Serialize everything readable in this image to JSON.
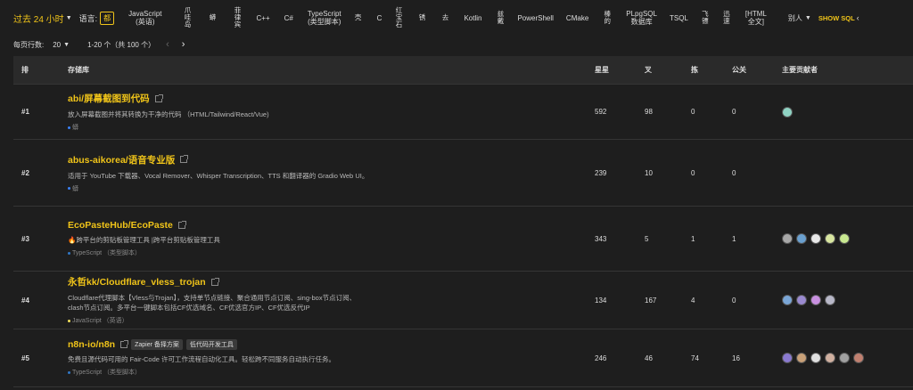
{
  "filters": {
    "time_range": "过去 24 小时",
    "language_label": "语言:",
    "language_selected": "都",
    "languages": [
      {
        "label": "JavaScript\n(英语)",
        "stack": false
      },
      {
        "label": "爪哇岛",
        "stack": true
      },
      {
        "label": "蟒",
        "stack": true
      },
      {
        "label": "菲律宾",
        "stack": true
      },
      {
        "label": "C++",
        "stack": false
      },
      {
        "label": "C#",
        "stack": false
      },
      {
        "label": "TypeScript\n(类型脚本)",
        "stack": false
      },
      {
        "label": "壳",
        "stack": true
      },
      {
        "label": "C",
        "stack": false
      },
      {
        "label": "红宝石",
        "stack": true
      },
      {
        "label": "锈",
        "stack": true
      },
      {
        "label": "去",
        "stack": true
      },
      {
        "label": "Kotlin",
        "stack": false
      },
      {
        "label": "兹戴",
        "stack": true
      },
      {
        "label": "PowerShell",
        "stack": false
      },
      {
        "label": "CMake",
        "stack": false
      },
      {
        "label": "榛的",
        "stack": true
      },
      {
        "label": "PLpgSQL\n数据库",
        "stack": false
      },
      {
        "label": "TSQL",
        "stack": false
      },
      {
        "label": "飞镖",
        "stack": true
      },
      {
        "label": "迅速",
        "stack": true
      },
      {
        "label": "[HTML\n全文]",
        "stack": false
      }
    ],
    "more_label": "别人",
    "show_sql_label": "SHOW SQL"
  },
  "pager": {
    "rows_per_page_label": "每页行数:",
    "rows_per_page_value": "20",
    "range_text": "1-20 个（共 100 个）"
  },
  "table": {
    "headers": {
      "rank": "排",
      "repo": "存储库",
      "stars": "星星",
      "forks": "叉",
      "merges": "拣",
      "issues": "公关",
      "contributors": "主要贡献者"
    },
    "rows": [
      {
        "rank": "#1",
        "name": "abi/屏幕截图到代码",
        "tags": [],
        "description": "放入屏幕截图并将其转换为干净的代码 （HTML/Tailwind/React/Vue)",
        "language": "蟒",
        "stars": "592",
        "forks": "98",
        "merges": "0",
        "issues": "0",
        "avatar_colors": [
          "#8fd3c3"
        ]
      },
      {
        "rank": "#2",
        "name": "abus-aikorea/语音专业版",
        "tags": [],
        "description": "适用于 YouTube 下载器、Vocal Remover、Whisper Transcription、TTS 和翻译器的 Gradio Web UI。",
        "language": "蟒",
        "stars": "239",
        "forks": "10",
        "merges": "0",
        "issues": "0",
        "avatar_colors": []
      },
      {
        "rank": "#3",
        "name": "EcoPasteHub/EcoPaste",
        "tags": [],
        "description": "🔥跨平台的剪贴板管理工具 |跨平台剪贴板管理工具",
        "language": "TypeScript （类型脚本）",
        "stars": "343",
        "forks": "5",
        "merges": "1",
        "issues": "1",
        "avatar_colors": [
          "#a8a8a8",
          "#6aa0d0",
          "#e8e8e8",
          "#d8e6a0",
          "#c8e890"
        ]
      },
      {
        "rank": "#4",
        "name": "永哲kk/Cloudflare_vless_trojan",
        "tags": [],
        "description": "Cloudflare代理脚本【Vless与Trojan】，支持单节点链接、聚合通用节点订阅、sing-box节点订阅、clash节点订阅。多平台一键脚本包括CF优选域名、CF优选官方IP、CF优选反代IP",
        "language": "JavaScript （英语）",
        "stars": "134",
        "forks": "167",
        "merges": "4",
        "issues": "0",
        "avatar_colors": [
          "#7aa6d6",
          "#9a8ad0",
          "#c890e0",
          "#b8b8c8"
        ]
      },
      {
        "rank": "#5",
        "name": "n8n-io/n8n",
        "tags": [
          "Zapier 备择方案",
          "低代码开发工具"
        ],
        "description": "免费且源代码可用的 Fair-Code 许可工作流程自动化工具。轻松跨不同服务自动执行任务。",
        "language": "TypeScript （类型脚本）",
        "stars": "246",
        "forks": "46",
        "merges": "74",
        "issues": "16",
        "avatar_colors": [
          "#8a7ad0",
          "#c8a078",
          "#e0e0e0",
          "#d0b0a0",
          "#a0a0a0",
          "#c08070"
        ]
      }
    ]
  }
}
